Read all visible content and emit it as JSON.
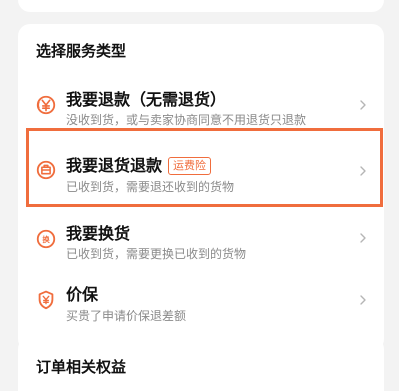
{
  "service_section": {
    "title": "选择服务类型",
    "options": [
      {
        "label": "我要退款（无需退货）",
        "description": "没收到货，或与卖家协商同意不用退货只退款",
        "icon": "refund-coin-icon"
      },
      {
        "label": "我要退货退款",
        "badge": "运费险",
        "description": "已收到货，需要退还收到的货物",
        "icon": "return-package-icon",
        "selected": true
      },
      {
        "label": "我要换货",
        "description": "已收到货，需要更换已收到的货物",
        "icon": "exchange-icon"
      },
      {
        "label": "价保",
        "description": "买贵了申请价保退差额",
        "icon": "price-protection-shield-icon"
      }
    ]
  },
  "benefits_section": {
    "title": "订单相关权益"
  },
  "colors": {
    "accent": "#f06d3d",
    "text_primary": "#111111",
    "text_secondary": "#8a8a8a",
    "background": "#f3f3f3",
    "card": "#ffffff"
  }
}
